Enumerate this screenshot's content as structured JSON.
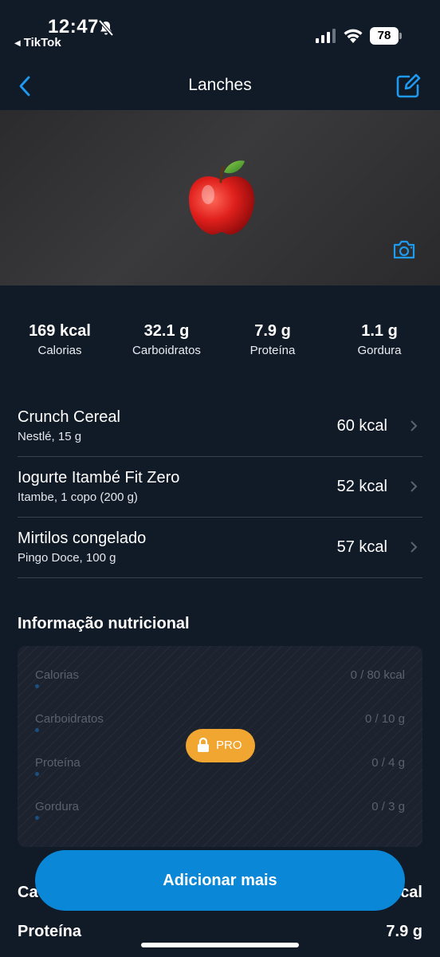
{
  "status_bar": {
    "time": "12:47",
    "back_app": "TikTok",
    "battery": "78"
  },
  "nav": {
    "title": "Lanches",
    "accent_color": "#1e9bf0"
  },
  "hero": {
    "image": "apple-emoji"
  },
  "summary": [
    {
      "value": "169 kcal",
      "label": "Calorias"
    },
    {
      "value": "32.1 g",
      "label": "Carboidratos"
    },
    {
      "value": "7.9 g",
      "label": "Proteína"
    },
    {
      "value": "1.1 g",
      "label": "Gordura"
    }
  ],
  "foods": [
    {
      "name": "Crunch Cereal",
      "detail": "Nestlé, 15 g",
      "kcal": "60 kcal"
    },
    {
      "name": "Iogurte Itambé Fit Zero",
      "detail": "Itambe, 1 copo (200 g)",
      "kcal": "52 kcal"
    },
    {
      "name": "Mirtilos congelado",
      "detail": "Pingo Doce, 100 g",
      "kcal": "57 kcal"
    }
  ],
  "nutrition": {
    "title": "Informação nutricional",
    "rows": [
      {
        "name": "Calorias",
        "value": "0 / 80 kcal"
      },
      {
        "name": "Carboidratos",
        "value": "0 / 10 g"
      },
      {
        "name": "Proteína",
        "value": "0 / 4 g"
      },
      {
        "name": "Gordura",
        "value": "0 / 3 g"
      }
    ],
    "pro_label": "PRO",
    "pro_color": "#f0a630"
  },
  "bottom_rows": [
    {
      "label": "Ca",
      "value": "cal"
    },
    {
      "label": "Proteína",
      "value": "7.9 g"
    }
  ],
  "add_button": {
    "label": "Adicionar mais",
    "color": "#0a87d6"
  }
}
